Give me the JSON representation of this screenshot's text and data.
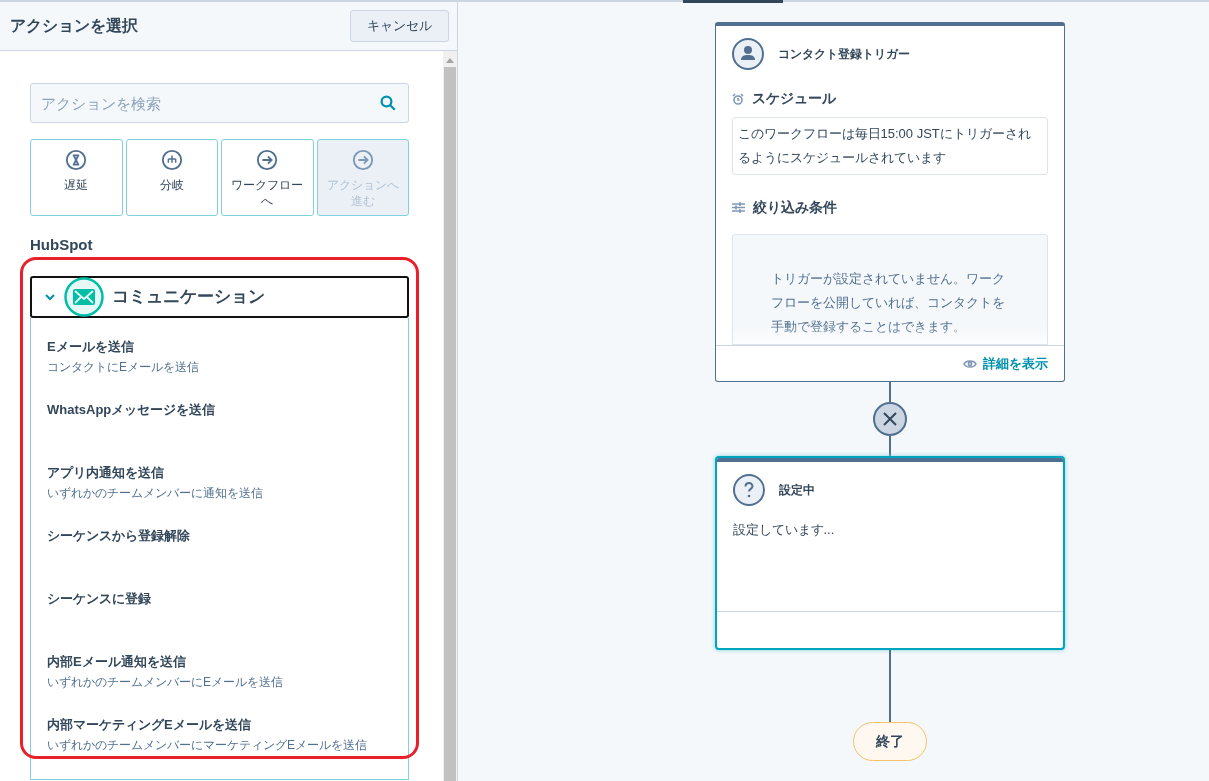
{
  "panel": {
    "title": "アクションを選択",
    "cancel_button": "キャンセル",
    "search": {
      "placeholder": "アクションを検索"
    },
    "quick_actions": [
      {
        "label": "遅延",
        "kind": "delay",
        "disabled": false
      },
      {
        "label": "分岐",
        "kind": "branch",
        "disabled": false
      },
      {
        "label": "ワークフローへ",
        "kind": "goto",
        "disabled": false
      },
      {
        "label": "アクションへ進む",
        "kind": "goto",
        "disabled": true
      }
    ],
    "section_label": "HubSpot",
    "category": {
      "label": "コミュニケーション",
      "expanded": true,
      "highlighted": true,
      "actions": [
        {
          "title": "Eメールを送信",
          "description": "コンタクトにEメールを送信"
        },
        {
          "title": "WhatsAppメッセージを送信"
        },
        {
          "title": "アプリ内通知を送信",
          "description": "いずれかのチームメンバーに通知を送信"
        },
        {
          "title": "シーケンスから登録解除"
        },
        {
          "title": "シーケンスに登録"
        },
        {
          "title": "内部Eメール通知を送信",
          "description": "いずれかのチームメンバーにEメールを送信"
        },
        {
          "title": "内部マーケティングEメールを送信",
          "description": "いずれかのチームメンバーにマーケティングEメールを送信"
        }
      ]
    }
  },
  "canvas": {
    "trigger_card": {
      "title": "コンタクト登録トリガー",
      "schedule_heading": "スケジュール",
      "schedule_text": "このワークフローは毎日15:00 JSTにトリガーされるようにスケジュールされています",
      "filter_heading": "絞り込み条件",
      "filter_text": "トリガーが設定されていません。ワークフローを公開していれば、コンタクトを手動で登録することはできます。",
      "details_link": "詳細を表示"
    },
    "action_card": {
      "title": "設定中",
      "body": "設定しています...",
      "selected": true
    },
    "end_node": "終了"
  }
}
